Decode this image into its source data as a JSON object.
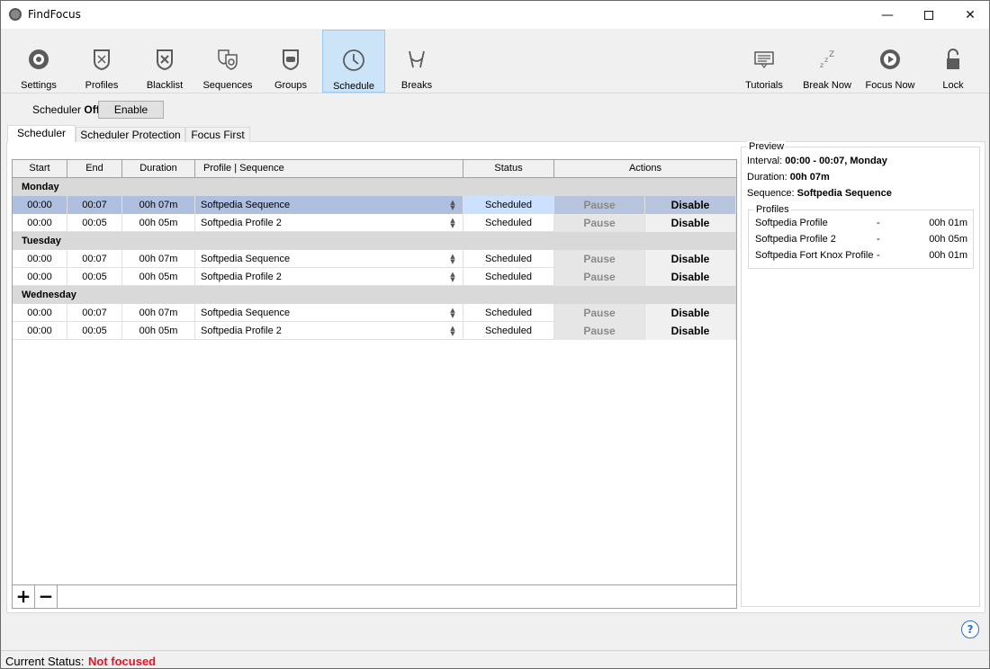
{
  "window": {
    "title": "FindFocus",
    "minimize": "—",
    "close": "✕"
  },
  "toolbar": {
    "items": [
      {
        "label": "Settings",
        "icon": "settings-icon"
      },
      {
        "label": "Profiles",
        "icon": "profiles-icon"
      },
      {
        "label": "Blacklist",
        "icon": "blacklist-icon"
      },
      {
        "label": "Sequences",
        "icon": "sequences-icon"
      },
      {
        "label": "Groups",
        "icon": "groups-icon"
      },
      {
        "label": "Schedule",
        "icon": "schedule-icon",
        "active": true
      },
      {
        "label": "Breaks",
        "icon": "breaks-icon"
      },
      {
        "label": "Tutorials",
        "icon": "tutorials-icon"
      },
      {
        "label": "Break Now",
        "icon": "break-now-icon"
      },
      {
        "label": "Focus Now",
        "icon": "focus-now-icon"
      },
      {
        "label": "Lock",
        "icon": "lock-icon"
      }
    ]
  },
  "scheduler": {
    "label": "Scheduler",
    "state": "Off",
    "enable_label": "Enable"
  },
  "tabs": [
    "Scheduler",
    "Scheduler Protection",
    "Focus First"
  ],
  "table": {
    "columns": [
      "Start",
      "End",
      "Duration",
      "Profile | Sequence",
      "Status",
      "Actions"
    ],
    "groups": [
      {
        "day": "Monday",
        "rows": [
          {
            "start": "00:00",
            "end": "00:07",
            "duration": "00h 07m",
            "profile": "Softpedia Sequence",
            "status": "Scheduled",
            "pause": "Pause",
            "disable": "Disable",
            "selected": true
          },
          {
            "start": "00:00",
            "end": "00:05",
            "duration": "00h 05m",
            "profile": "Softpedia Profile 2",
            "status": "Scheduled",
            "pause": "Pause",
            "disable": "Disable"
          }
        ]
      },
      {
        "day": "Tuesday",
        "rows": [
          {
            "start": "00:00",
            "end": "00:07",
            "duration": "00h 07m",
            "profile": "Softpedia Sequence",
            "status": "Scheduled",
            "pause": "Pause",
            "disable": "Disable"
          },
          {
            "start": "00:00",
            "end": "00:05",
            "duration": "00h 05m",
            "profile": "Softpedia Profile 2",
            "status": "Scheduled",
            "pause": "Pause",
            "disable": "Disable"
          }
        ]
      },
      {
        "day": "Wednesday",
        "rows": [
          {
            "start": "00:00",
            "end": "00:07",
            "duration": "00h 07m",
            "profile": "Softpedia Sequence",
            "status": "Scheduled",
            "pause": "Pause",
            "disable": "Disable"
          },
          {
            "start": "00:00",
            "end": "00:05",
            "duration": "00h 05m",
            "profile": "Softpedia Profile 2",
            "status": "Scheduled",
            "pause": "Pause",
            "disable": "Disable"
          }
        ]
      }
    ],
    "add_label": "+",
    "remove_label": "−"
  },
  "preview": {
    "title": "Preview",
    "interval_label": "Interval:",
    "interval_value": "00:00 - 00:07, Monday",
    "duration_label": "Duration:",
    "duration_value": "00h 07m",
    "sequence_label": "Sequence:",
    "sequence_value": "Softpedia Sequence",
    "profiles_title": "Profiles",
    "profiles": [
      {
        "name": "Softpedia Profile",
        "dash": "-",
        "duration": "00h 01m"
      },
      {
        "name": "Softpedia Profile 2",
        "dash": "-",
        "duration": "00h 05m"
      },
      {
        "name": "Softpedia Fort Knox Profile",
        "dash": "-",
        "duration": "00h 01m"
      }
    ]
  },
  "help": "?",
  "status": {
    "label": "Current Status:",
    "value": "Not focused",
    "value_color": "#e81123"
  }
}
